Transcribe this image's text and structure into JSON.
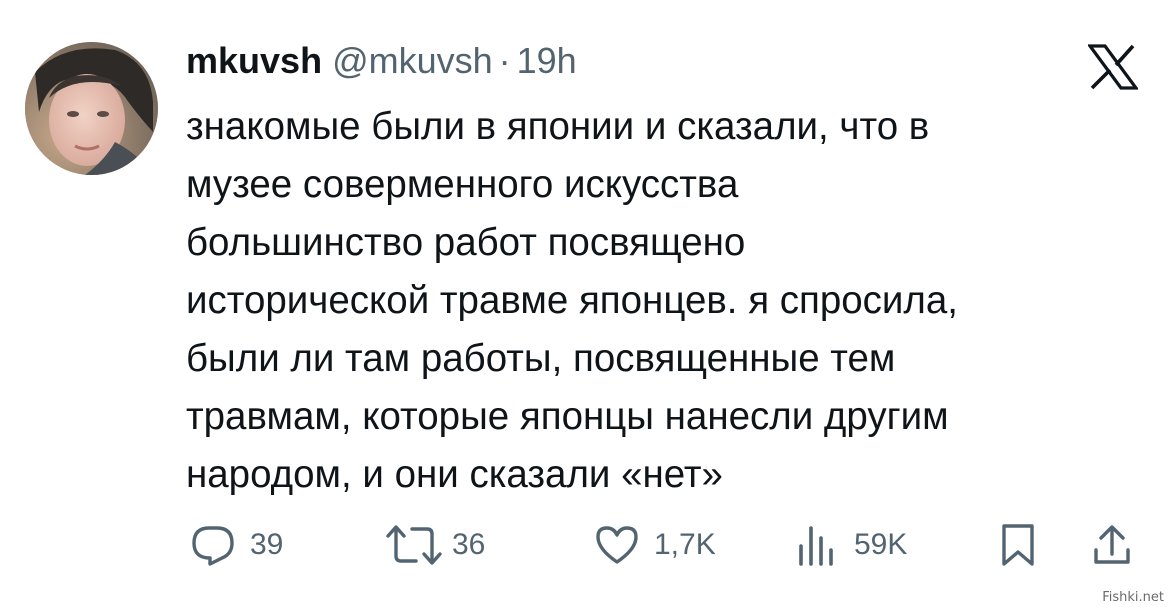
{
  "author": {
    "display_name": "mkuvsh",
    "handle": "@mkuvsh",
    "separator": "·",
    "time": "19h"
  },
  "tweet": {
    "lines": [
      "знакомые были в японии и сказали, что в",
      "музее соверменного искусства",
      "большинство работ посвящено",
      "исторической травме японцев. я спросила,",
      "были ли там работы, посвященные тем",
      "травмам, которые японцы нанесли другим",
      "народом, и они сказали «нет»"
    ]
  },
  "actions": {
    "replies": "39",
    "reposts": "36",
    "likes": "1,7K",
    "views": "59K"
  },
  "icons": {
    "logo": "x-logo-icon",
    "reply": "reply-icon",
    "repost": "repost-icon",
    "like": "like-icon",
    "views": "views-icon",
    "bookmark": "bookmark-icon",
    "share": "share-icon"
  },
  "colors": {
    "text": "#0f1419",
    "secondary": "#536471",
    "background": "#ffffff"
  },
  "watermark": "Fishki.net"
}
